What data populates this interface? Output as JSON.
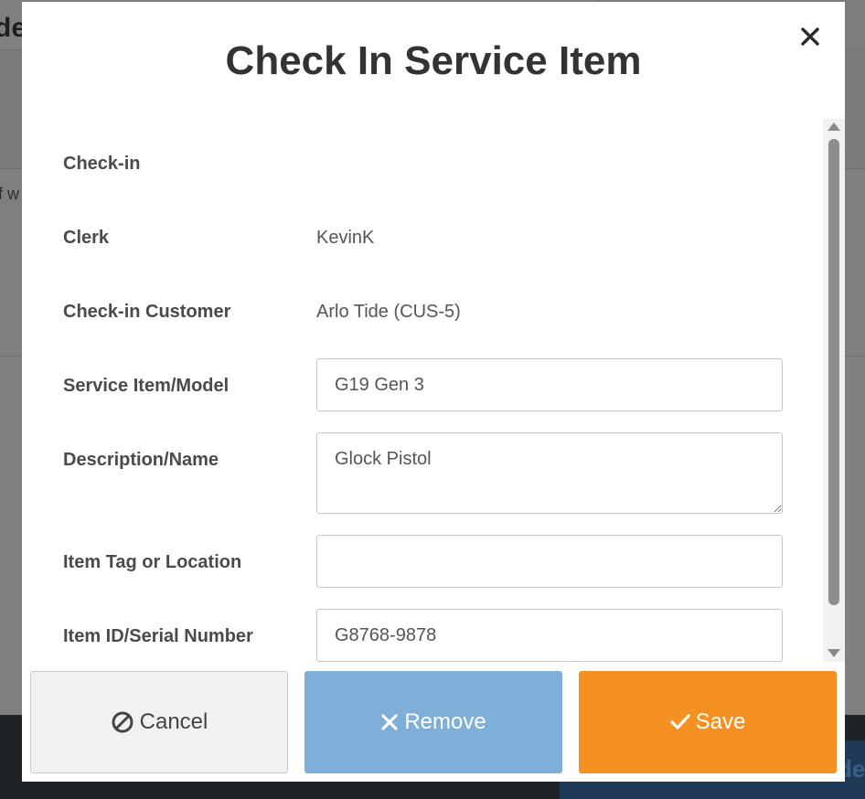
{
  "background": {
    "title_fragment": "de",
    "snippet_fragment": "f w",
    "footer_fragment": "de"
  },
  "modal": {
    "title": "Check In Service Item",
    "close_icon": "close-icon"
  },
  "form": {
    "checkin_label": "Check-in",
    "clerk_label": "Clerk",
    "clerk_value": "KevinK",
    "customer_label": "Check-in Customer",
    "customer_value": "Arlo Tide (CUS-5)",
    "service_item_label": "Service Item/Model",
    "service_item_value": "G19 Gen 3",
    "description_label": "Description/Name",
    "description_value": "Glock Pistol",
    "tag_label": "Item Tag or Location",
    "tag_value": "",
    "serial_label": "Item ID/Serial Number",
    "serial_value": "G8768-9878"
  },
  "buttons": {
    "cancel_label": "Cancel",
    "cancel_icon": "ban-icon",
    "remove_label": "Remove",
    "remove_icon": "x-icon",
    "save_label": "Save",
    "save_icon": "check-icon"
  },
  "colors": {
    "save": "#f59122",
    "remove": "#7eafd8",
    "cancel": "#f2f1f1"
  }
}
